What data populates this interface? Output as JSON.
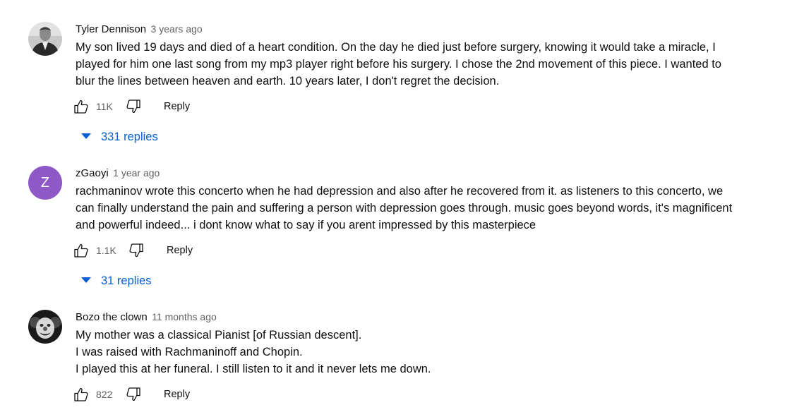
{
  "comments": [
    {
      "author": "Tyler Dennison",
      "time": "3 years ago",
      "avatar": {
        "kind": "photo",
        "icon": "person-photo-avatar-icon"
      },
      "lines": [
        "My son lived 19 days and died of a heart condition. On the day he died just before surgery, knowing it would take a miracle, I",
        "played for him one last song from my mp3 player right before his surgery. I chose the 2nd movement of this piece. I wanted to",
        "blur the lines between heaven and earth. 10 years later, I don't regret the decision."
      ],
      "likes": "11K",
      "reply_label": "Reply",
      "replies_label": "331 replies"
    },
    {
      "author": "zGaoyi",
      "time": "1 year ago",
      "avatar": {
        "kind": "letter",
        "letter": "Z",
        "color": "#8e59c6"
      },
      "lines": [
        "rachmaninov wrote this concerto when he had depression and also after he recovered from it. as listeners to this concerto, we",
        "can finally understand the pain and suffering a person with depression goes through. music goes beyond words, it's magnificent",
        "and powerful indeed... i dont know what to say if you arent impressed by this masterpiece"
      ],
      "likes": "1.1K",
      "reply_label": "Reply",
      "replies_label": "31 replies"
    },
    {
      "author": "Bozo the clown",
      "time": "11 months ago",
      "avatar": {
        "kind": "photo",
        "icon": "clown-photo-avatar-icon"
      },
      "lines": [
        "My mother was a classical Pianist [of Russian descent].",
        "I was raised with Rachmaninoff and Chopin.",
        "I played this at her funeral. I still listen to it and it never lets me down."
      ],
      "likes": "822",
      "reply_label": "Reply"
    }
  ],
  "icons": {
    "like": "thumbs-up-icon",
    "dislike": "thumbs-down-icon",
    "expand": "chevron-down-icon"
  },
  "colors": {
    "link_blue": "#065fd4",
    "secondary_text": "#606060",
    "primary_text": "#0f0f0f"
  }
}
